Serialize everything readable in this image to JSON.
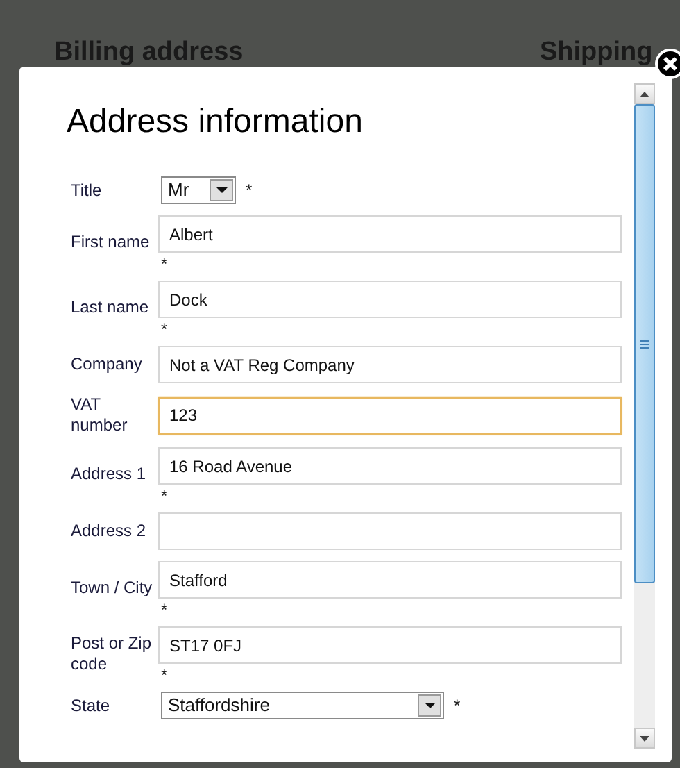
{
  "background": {
    "headings": [
      "Billing address",
      "Shipping"
    ]
  },
  "dialog": {
    "title": "Address information",
    "fields": [
      {
        "kind": "select",
        "label": "Title",
        "value": "Mr",
        "required_mark": "*",
        "focused": false
      },
      {
        "kind": "text",
        "label": "First name",
        "value": "Albert",
        "required_mark": "*",
        "focused": false
      },
      {
        "kind": "text",
        "label": "Last name",
        "value": "Dock",
        "required_mark": "*",
        "focused": false
      },
      {
        "kind": "text",
        "label": "Company",
        "value": "Not a VAT Reg Company",
        "focused": false
      },
      {
        "kind": "text",
        "label": "VAT number",
        "value": "123",
        "focused": true
      },
      {
        "kind": "text",
        "label": "Address 1",
        "value": "16 Road Avenue",
        "required_mark": "*",
        "focused": false
      },
      {
        "kind": "text",
        "label": "Address 2",
        "focused": false
      },
      {
        "kind": "text",
        "label": "Town / City",
        "value": "Stafford",
        "required_mark": "*",
        "focused": false
      },
      {
        "kind": "text",
        "label": "Post or Zip code",
        "value": "ST17 0FJ",
        "required_mark": "*",
        "focused": false
      },
      {
        "kind": "wideselect",
        "label": "State",
        "value": "Staffordshire",
        "required_mark": "*",
        "focused": false
      }
    ]
  }
}
